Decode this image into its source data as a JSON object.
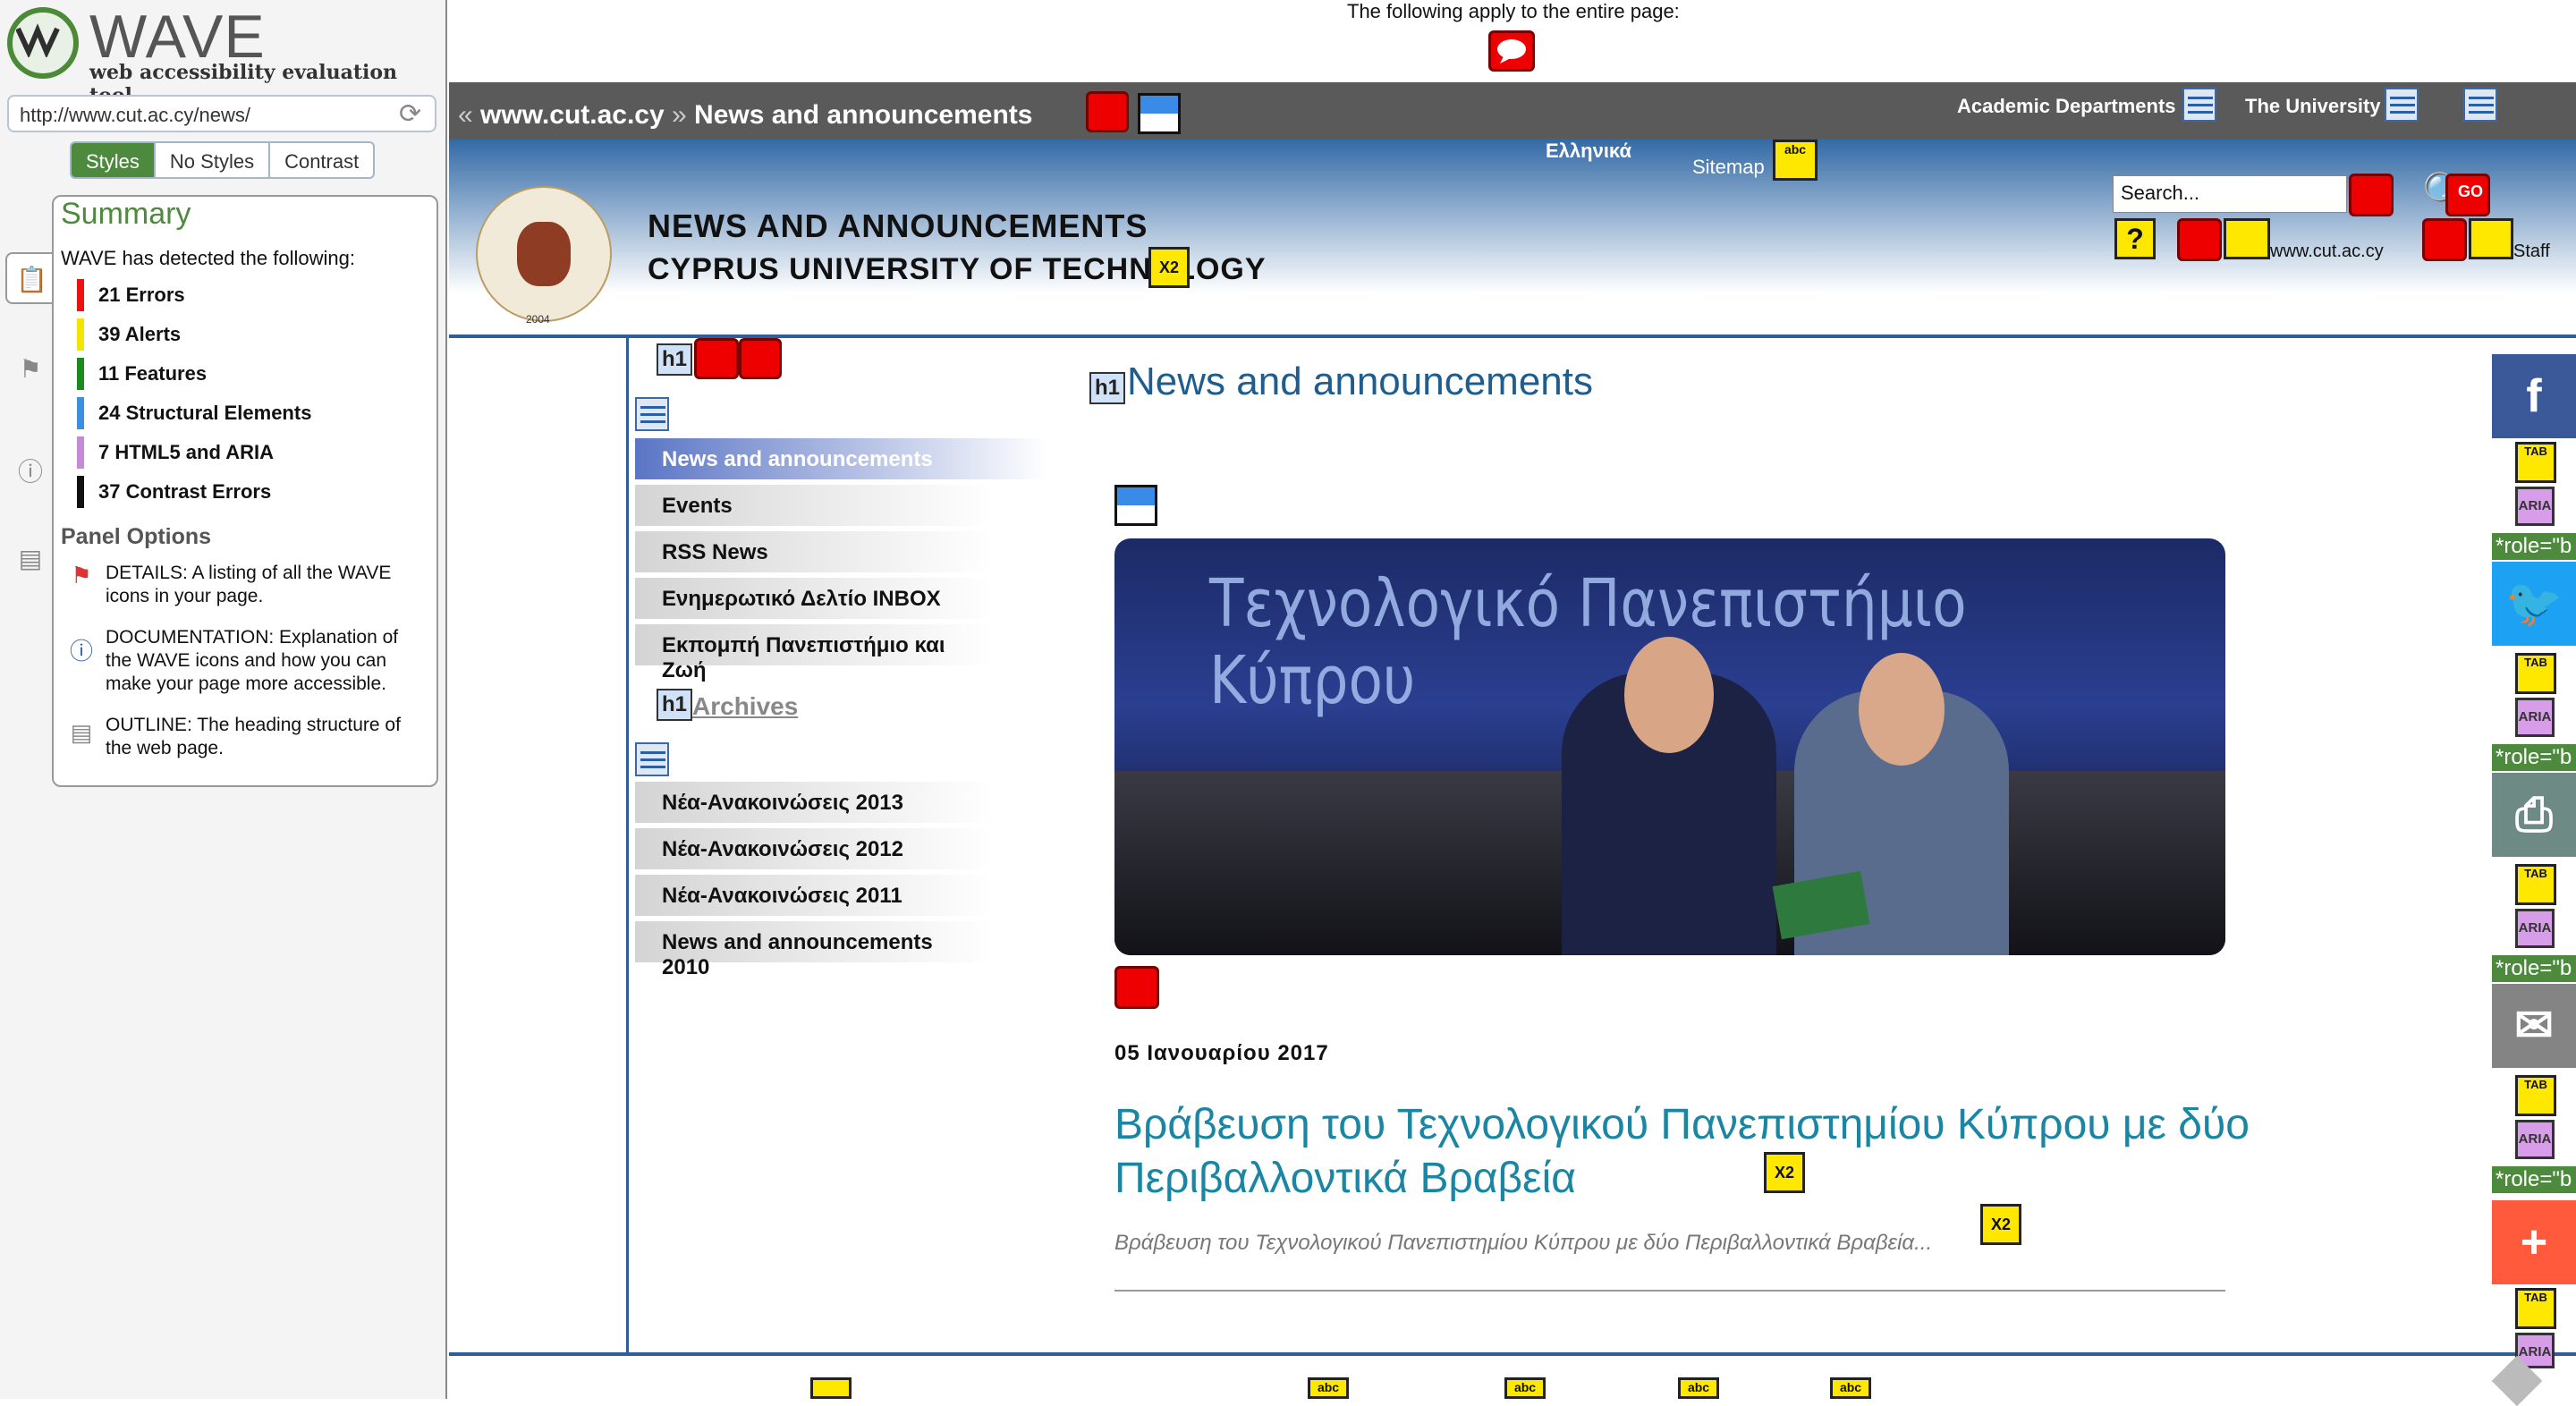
{
  "wave": {
    "logo": "WAVE",
    "tagline": "web accessibility evaluation tool",
    "url": "http://www.cut.ac.cy/news/",
    "tabs": [
      "Styles",
      "No Styles",
      "Contrast"
    ],
    "summary_title": "Summary",
    "detected_text": "WAVE has detected the following:",
    "counts": [
      {
        "label": "21 Errors",
        "color": "#ee1111"
      },
      {
        "label": "39 Alerts",
        "color": "#f2e600"
      },
      {
        "label": "11 Features",
        "color": "#1d8a1d"
      },
      {
        "label": "24 Structural Elements",
        "color": "#3d8fe0"
      },
      {
        "label": "7 HTML5 and ARIA",
        "color": "#c78ad8"
      },
      {
        "label": "37 Contrast Errors",
        "color": "#111111"
      }
    ],
    "panel_options_title": "Panel Options",
    "panel_options": [
      {
        "label": "DETAILS: A listing of all the WAVE icons in your page.",
        "icon": "flag-icon"
      },
      {
        "label": "DOCUMENTATION: Explanation of the WAVE icons and how you can make your page more accessible.",
        "icon": "info-icon"
      },
      {
        "label": "OUTLINE: The heading structure of the web page.",
        "icon": "outline-icon"
      }
    ]
  },
  "page": {
    "apply_text": "The following apply to the entire page:",
    "breadcrumb": {
      "prefix": "«",
      "site": "www.cut.ac.cy",
      "sep": "»",
      "current": "News and announcements"
    },
    "top_nav": [
      "Academic Departments",
      "The University"
    ],
    "lang_link": "Ελληνικά",
    "sitemap_link": "Sitemap",
    "header_title": "NEWS AND ANNOUNCEMENTS",
    "header_subtitle": "CYPRUS UNIVERSITY OF TECHNOLOGY",
    "crest_year": "2004",
    "search_placeholder": "Search...",
    "search_options": [
      "www.cut.ac.cy",
      "Staff"
    ],
    "go_label": "GO",
    "left_nav": [
      "News and announcements",
      "Events",
      "RSS News",
      "Ενημερωτικό Δελτίο INBOX",
      "Εκπομπή Πανεπιστήμιο και Ζωή"
    ],
    "archives_title": "Archives",
    "archives": [
      "Νέα-Ανακοινώσεις 2013",
      "Νέα-Ανακοινώσεις 2012",
      "Νέα-Ανακοινώσεις 2011",
      "News and announcements 2010"
    ],
    "main_title": "News and announcements",
    "hero_banner_text": "Τεχνολογικό Πανεπιστήμιο Κύπρου",
    "article_date": "05 Ιανουαρίου 2017",
    "article_title": "Βράβευση του Τεχνολογικού Πανεπιστημίου Κύπρου με δύο Περιβαλλοντικά Βραβεία",
    "article_summary": "Βράβευση του Τεχνολογικού Πανεπιστημίου Κύπρου με δύο Περιβαλλοντικά Βραβεία...",
    "role_tag": "*role=\"b",
    "social": [
      {
        "icon": "facebook-icon",
        "glyph": "f",
        "color": "#3b5998"
      },
      {
        "icon": "twitter-icon",
        "glyph": "🐦",
        "color": "#1da1f2"
      },
      {
        "icon": "print-icon",
        "glyph": "⎙",
        "color": "#6d8a84"
      },
      {
        "icon": "email-icon",
        "glyph": "✉",
        "color": "#848484"
      },
      {
        "icon": "share-plus-icon",
        "glyph": "+",
        "color": "#ff5a3c"
      }
    ],
    "wave_icon_labels": {
      "h1": "h1",
      "x2": "X2",
      "abc": "abc",
      "aria": "ARIA",
      "tab": "TAB"
    }
  }
}
